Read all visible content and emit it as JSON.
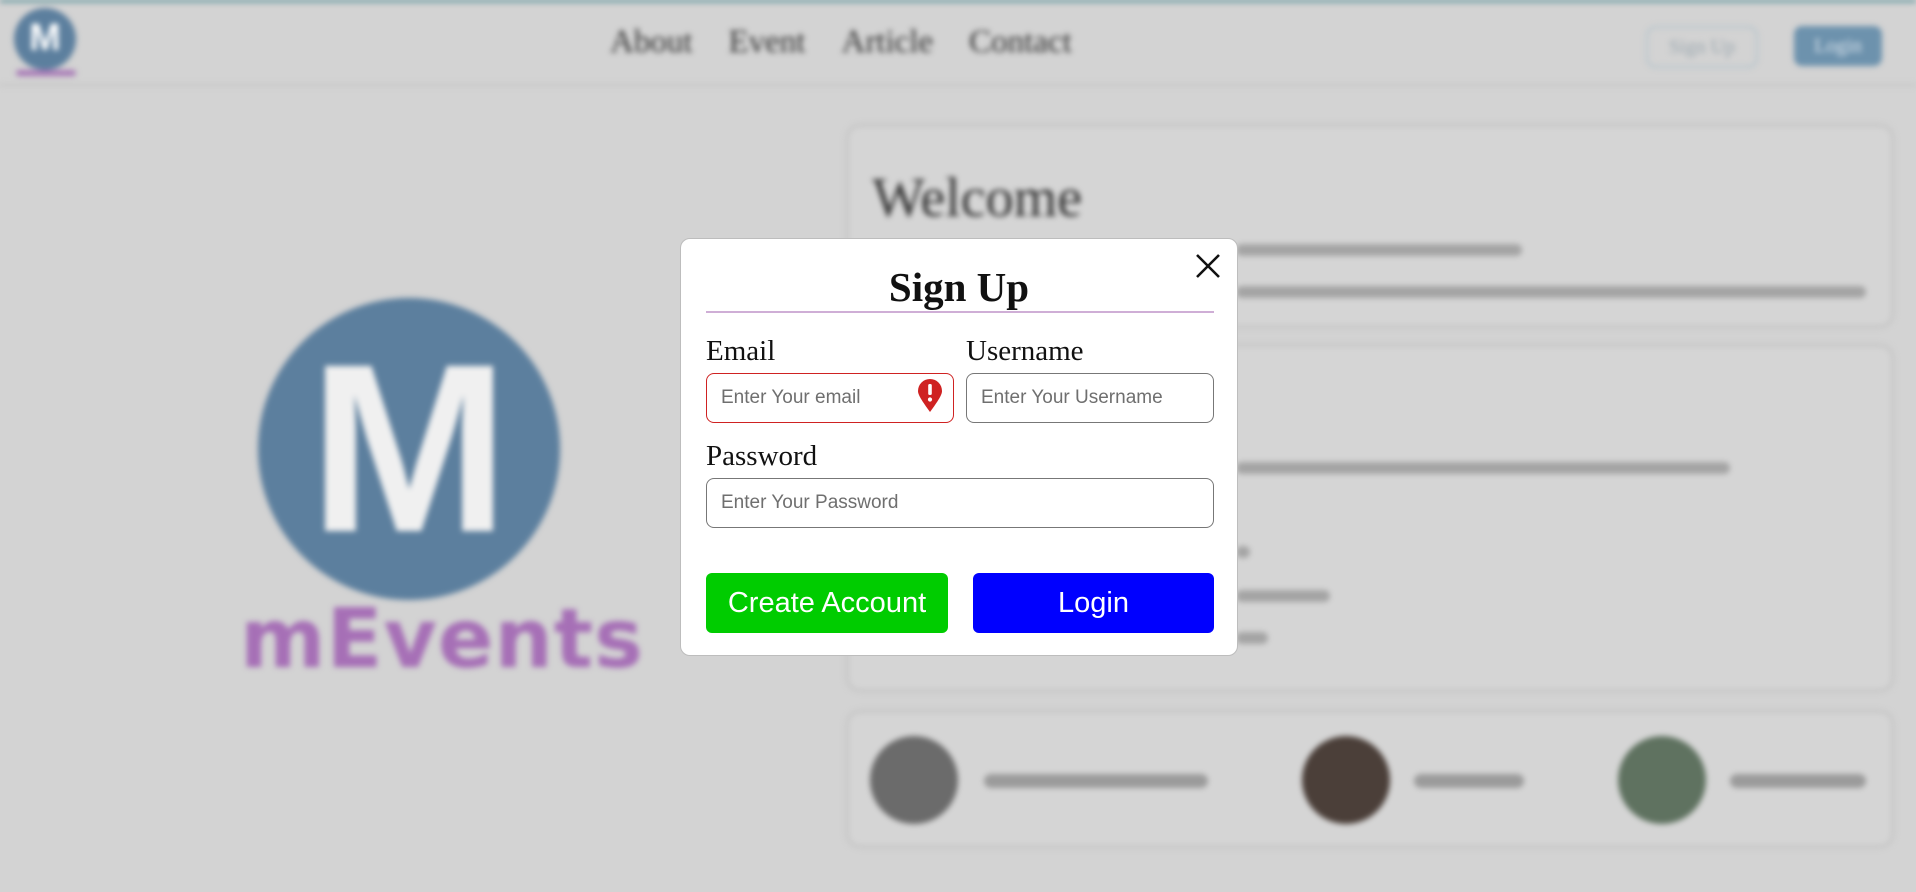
{
  "background": {
    "logo_small_letter": "M",
    "nav": [
      {
        "label": "About"
      },
      {
        "label": "Event"
      },
      {
        "label": "Article"
      },
      {
        "label": "Contact"
      }
    ],
    "header_signup": "Sign Up",
    "header_login": "Login",
    "logo_letter": "M",
    "logo_text": "mEvents",
    "welcome_title": "Welcome"
  },
  "modal": {
    "title": "Sign Up",
    "email_label": "Email",
    "email_placeholder": "Enter Your email",
    "username_label": "Username",
    "username_placeholder": "Enter Your Username",
    "password_label": "Password",
    "password_placeholder": "Enter Your Password",
    "create_account": "Create Account",
    "login": "Login"
  },
  "colors": {
    "create_button": "#00cc00",
    "login_button": "#0000ff",
    "error": "#cf2222",
    "brand_blue": "#5c7f9e",
    "brand_purple": "#a66fb6"
  }
}
